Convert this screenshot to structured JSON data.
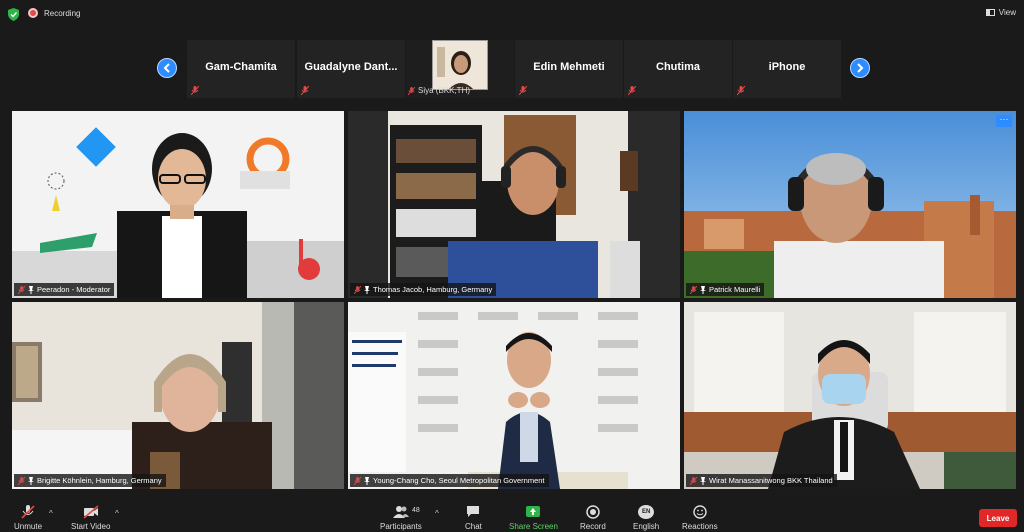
{
  "topbar": {
    "recording_label": "Recording",
    "view_label": "View",
    "colors": {
      "shield": "#2fb34a",
      "recording": "#e04b4b"
    }
  },
  "filmstrip": {
    "prev_icon": "chevron-left-icon",
    "next_icon": "chevron-right-icon",
    "participants": [
      {
        "name": "Gam-Chamita"
      },
      {
        "name": "Guadalyne Dant..."
      },
      {
        "name": "Siya (BKK,TH)"
      },
      {
        "name": "Edin Mehmeti"
      },
      {
        "name": "Chutima"
      },
      {
        "name": "iPhone"
      }
    ]
  },
  "gallery": {
    "tiles": [
      {
        "name": "Peeradon - Moderator"
      },
      {
        "name": "Thomas Jacob, Hamburg, Germany"
      },
      {
        "name": "Patrick Maurelli"
      },
      {
        "name": "Brigitte Köhnlein, Hamburg, Germany"
      },
      {
        "name": "Young-Chang Cho, Seoul Metropolitan Government"
      },
      {
        "name": "Wirat Manassanitwong BKK Thailand"
      }
    ],
    "more_button": "···"
  },
  "toolbar": {
    "unmute": "Unmute",
    "start_video": "Start Video",
    "participants": "Participants",
    "participants_count": "48",
    "chat": "Chat",
    "share_screen": "Share Screen",
    "record": "Record",
    "english": "English",
    "english_badge": "EN",
    "reactions": "Reactions",
    "leave": "Leave",
    "caret": "^",
    "colors": {
      "share": "#5fd36a",
      "leave": "#e02828",
      "accent": "#2d8cff"
    }
  }
}
